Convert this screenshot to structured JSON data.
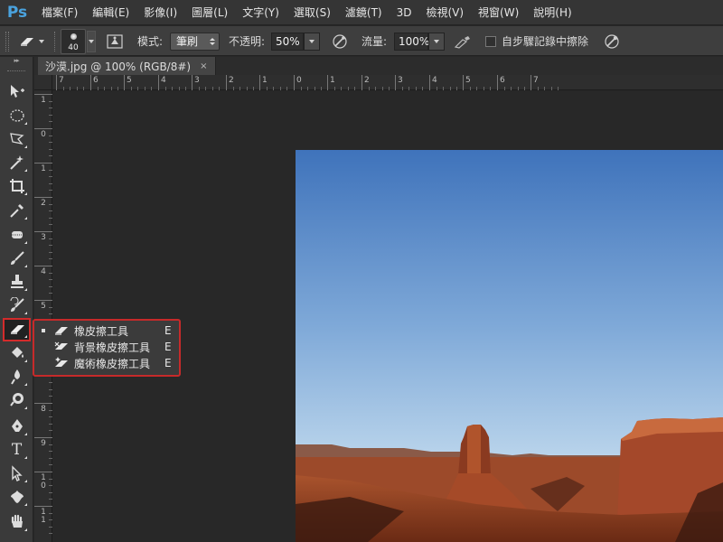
{
  "app": {
    "logo": "Ps"
  },
  "menu": [
    "檔案(F)",
    "編輯(E)",
    "影像(I)",
    "圖層(L)",
    "文字(Y)",
    "選取(S)",
    "濾鏡(T)",
    "3D",
    "檢視(V)",
    "視窗(W)",
    "說明(H)"
  ],
  "options": {
    "brush_size": "40",
    "mode_label": "模式:",
    "mode_value": "筆刷",
    "opacity_label": "不透明:",
    "opacity_value": "50%",
    "flow_label": "流量:",
    "flow_value": "100%",
    "erase_history_label": "自步驟記錄中擦除",
    "erase_history_checked": false
  },
  "document": {
    "tab_title": "沙漠.jpg @ 100% (RGB/8#)",
    "close_glyph": "×"
  },
  "ruler_h": [
    "7",
    "6",
    "5",
    "4",
    "3",
    "2",
    "1",
    "0",
    "1",
    "2",
    "3",
    "4",
    "5",
    "6",
    "7"
  ],
  "ruler_v": [
    "1",
    "0",
    "1",
    "2",
    "3",
    "4",
    "5",
    "6",
    "7",
    "8",
    "9",
    "10",
    "11"
  ],
  "toolbar": {
    "tools": [
      "move-tool-icon",
      "elliptical-marquee-icon",
      "polygon-lasso-icon",
      "magic-wand-icon",
      "crop-icon",
      "eyedropper-icon",
      "spot-healing-icon",
      "brush-icon",
      "clone-stamp-icon",
      "history-brush-icon",
      "eraser-icon",
      "paint-bucket-icon",
      "blur-icon",
      "dodge-icon",
      "pen-icon",
      "type-icon",
      "path-selection-icon",
      "custom-shape-icon",
      "hand-icon"
    ],
    "text_tool_glyph": "T"
  },
  "flyout": {
    "items": [
      {
        "label": "橡皮擦工具",
        "shortcut": "E",
        "selected": true,
        "icon": "eraser-icon"
      },
      {
        "label": "背景橡皮擦工具",
        "shortcut": "E",
        "selected": false,
        "icon": "background-eraser-icon"
      },
      {
        "label": "魔術橡皮擦工具",
        "shortcut": "E",
        "selected": false,
        "icon": "magic-eraser-icon"
      }
    ]
  },
  "colors": {
    "highlight": "#c62a2a",
    "logo": "#4aa3df",
    "sky_top": "#4a7bc0",
    "sky_bottom": "#c9dff0",
    "rock": "#a8462a"
  }
}
